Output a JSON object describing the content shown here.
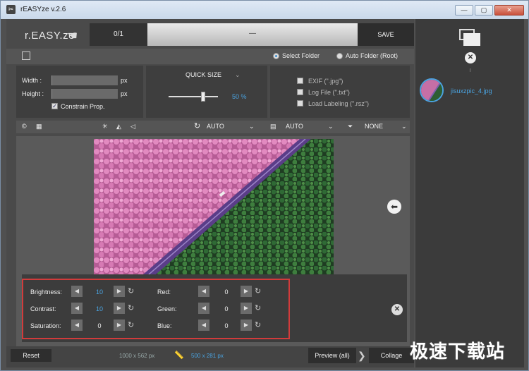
{
  "window": {
    "title": "rEASYze v.2.6"
  },
  "header": {
    "logo": "r.EASY.ze",
    "counter": "0/1",
    "progress_text": "—",
    "save_label": "SAVE"
  },
  "output": {
    "select_folder": "Select Folder",
    "auto_folder": "Auto Folder (Root)",
    "selected": "select_folder"
  },
  "size": {
    "width_label": "Width :",
    "height_label": "Height :",
    "width_value": "",
    "height_value": "",
    "unit": "px",
    "constrain_label": "Constrain Prop.",
    "constrain_checked": true
  },
  "quick_size": {
    "label": "QUICK SIZE",
    "value": "50 %",
    "fraction": 0.5
  },
  "options": {
    "exif": "EXIF (\".jpg\")",
    "log": "Log File (\".txt\")",
    "labeling": "Load Labeling (\".rsz\")"
  },
  "toolbar": {
    "rotate_value": "AUTO",
    "format_value": "AUTO",
    "filter_value": "NONE"
  },
  "adjustments": {
    "brightness": {
      "label": "Brightness:",
      "value": "10"
    },
    "contrast": {
      "label": "Contrast:",
      "value": "10"
    },
    "saturation": {
      "label": "Saturation:",
      "value": "0"
    },
    "red": {
      "label": "Red:",
      "value": "0"
    },
    "green": {
      "label": "Green:",
      "value": "0"
    },
    "blue": {
      "label": "Blue:",
      "value": "0"
    }
  },
  "footer": {
    "reset_label": "Reset",
    "original_size": "1000 x 562 px",
    "new_size": "500 x 281 px",
    "preview_label": "Preview (all)",
    "collage_label": "Collage"
  },
  "files": [
    {
      "name": "jisuxzpic_4.jpg"
    }
  ],
  "watermark": "极速下载站",
  "colors": {
    "accent": "#4aa3e0",
    "highlight": "#d23b3b"
  }
}
